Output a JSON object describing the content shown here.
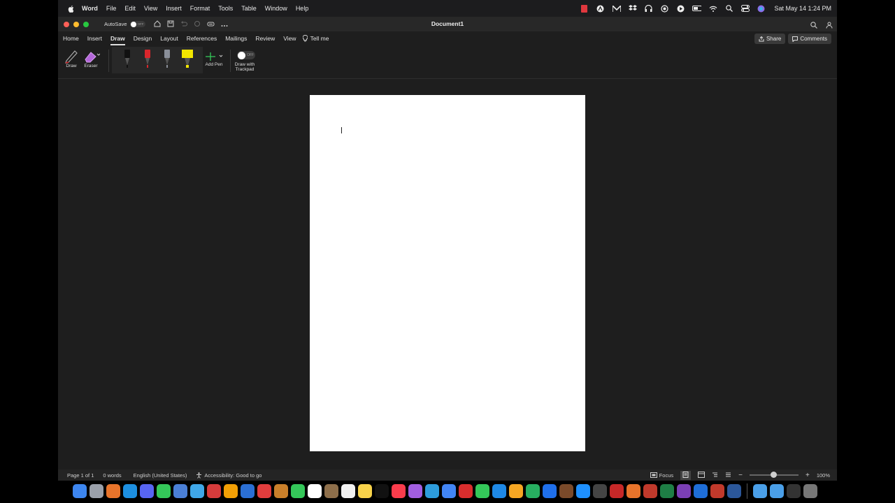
{
  "menubar": {
    "app_name": "Word",
    "items": [
      "File",
      "Edit",
      "View",
      "Insert",
      "Format",
      "Tools",
      "Table",
      "Window",
      "Help"
    ],
    "clock": "Sat May 14  1:24 PM"
  },
  "window": {
    "title": "Document1",
    "autosave_label": "AutoSave",
    "autosave_state": "OFF"
  },
  "ribbon": {
    "tabs": [
      "Home",
      "Insert",
      "Draw",
      "Design",
      "Layout",
      "References",
      "Mailings",
      "Review",
      "View"
    ],
    "active_tab": "Draw",
    "tell_me": "Tell me",
    "share_label": "Share",
    "comments_label": "Comments",
    "draw_label": "Draw",
    "eraser_label": "Eraser",
    "add_pen_label": "Add Pen",
    "trackpad_line1": "Draw with",
    "trackpad_line2": "Trackpad",
    "trackpad_state": "OFF",
    "pen_colors": [
      "#111111",
      "#d9262c",
      "#8a8f99",
      "#f2e600"
    ]
  },
  "status": {
    "page": "Page 1 of 1",
    "words": "0 words",
    "language": "English (United States)",
    "accessibility": "Accessibility: Good to go",
    "focus": "Focus",
    "zoom": "100%",
    "zoom_level": 0.5
  },
  "dock": {
    "icon_colors": [
      "#3d86f0",
      "#9aa0aa",
      "#e8742b",
      "#1d8fe0",
      "#5865f2",
      "#34c759",
      "#4a7fd6",
      "#3fa7e8",
      "#d63b3b",
      "#f29f05",
      "#2b6fd4",
      "#e23d3d",
      "#c97f2a",
      "#34c759",
      "#ffffff",
      "#8d6e4a",
      "#f0f0f0",
      "#f7d24a",
      "#111111",
      "#fa3c4c",
      "#a25ee0",
      "#2d9cdb",
      "#4285f4",
      "#d92d2d",
      "#34c759",
      "#1e88e5",
      "#f5a623",
      "#27ae60",
      "#1f6feb",
      "#7a4a2a",
      "#1e90ff",
      "#444444",
      "#c62828",
      "#e8742b",
      "#c0392b",
      "#1e7e45",
      "#7b3fb5",
      "#1e6ed8",
      "#c0392b",
      "#2b579a"
    ],
    "folder_colors": [
      "#4a9fe8",
      "#4a9fe8",
      "#333333",
      "#777777"
    ]
  }
}
